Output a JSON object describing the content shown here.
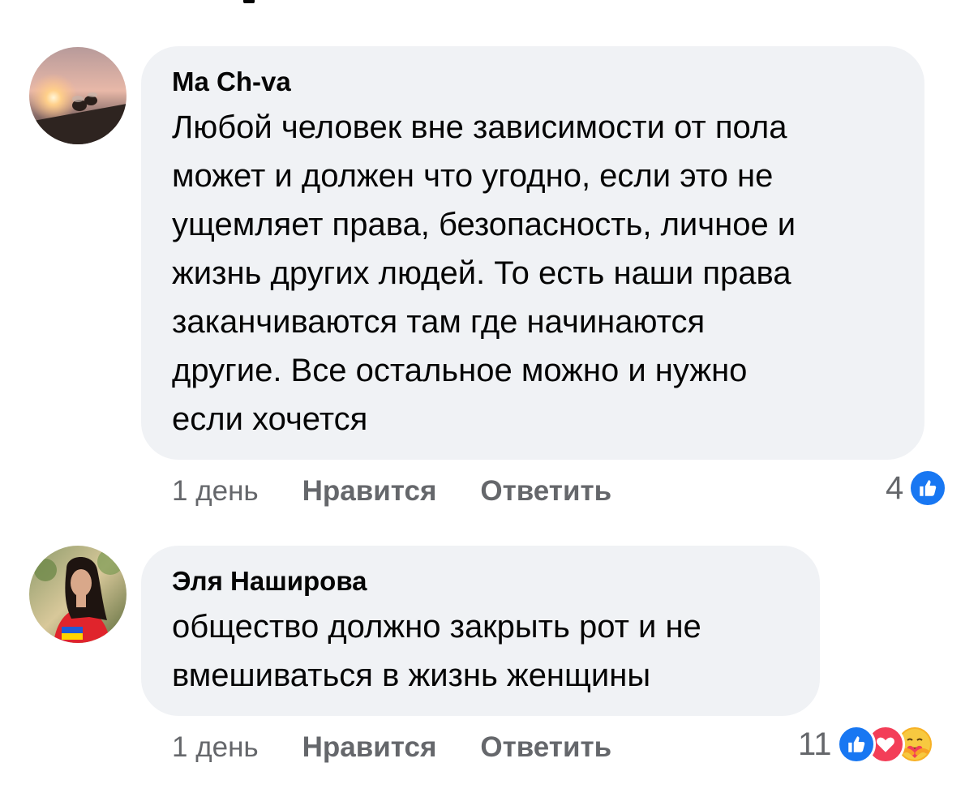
{
  "comments": [
    {
      "author": "Ma Ch-va",
      "text": "Любой человек вне зависимости от пола\nможет и должен что угодно, если это не\nущемляет права, безопасность, личное и\nжизнь других людей. То есть наши права\nзаканчиваются там где начинаются\nдругие. Все остальное можно и нужно\nесли хочется",
      "time": "1 день",
      "like_label": "Нравится",
      "reply_label": "Ответить",
      "reaction_count": "4",
      "reactions": [
        "like-icon"
      ]
    },
    {
      "author": "Эля Наширова",
      "text": "общество должно закрыть рот и не\nвмешиваться в жизнь женщины",
      "time": "1 день",
      "like_label": "Нравится",
      "reply_label": "Ответить",
      "reaction_count": "11",
      "reactions": [
        "like-icon",
        "love-icon",
        "care-icon"
      ]
    }
  ],
  "colors": {
    "bubble": "#f0f2f5",
    "meta_text": "#65676b",
    "like_blue": "#1877f2",
    "love_red": "#f33e58",
    "care_yellow": "#f7b125"
  }
}
